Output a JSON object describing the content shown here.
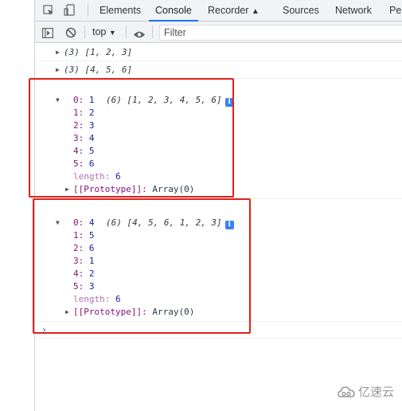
{
  "devtools": {
    "tabs": [
      {
        "label": "Elements",
        "active": false
      },
      {
        "label": "Console",
        "active": true
      },
      {
        "label": "Recorder",
        "active": false
      },
      {
        "label": "Sources",
        "active": false
      },
      {
        "label": "Network",
        "active": false
      },
      {
        "label": "Per",
        "active": false
      }
    ],
    "toolbar": {
      "context": "top",
      "filter_placeholder": "Filter"
    }
  },
  "console": {
    "collapsed": [
      {
        "summary": "(3) [1, 2, 3]"
      },
      {
        "summary": "(3) [4, 5, 6]"
      }
    ],
    "expanded": [
      {
        "summary": "(6) [1, 2, 3, 4, 5, 6]",
        "items": [
          {
            "key": "0:",
            "val": "1"
          },
          {
            "key": "1:",
            "val": "2"
          },
          {
            "key": "2:",
            "val": "3"
          },
          {
            "key": "3:",
            "val": "4"
          },
          {
            "key": "4:",
            "val": "5"
          },
          {
            "key": "5:",
            "val": "6"
          }
        ],
        "length_key": "length:",
        "length_val": "6",
        "proto_key": "[[Prototype]]:",
        "proto_val": "Array(0)"
      },
      {
        "summary": "(6) [4, 5, 6, 1, 2, 3]",
        "items": [
          {
            "key": "0:",
            "val": "4"
          },
          {
            "key": "1:",
            "val": "5"
          },
          {
            "key": "2:",
            "val": "6"
          },
          {
            "key": "3:",
            "val": "1"
          },
          {
            "key": "4:",
            "val": "2"
          },
          {
            "key": "5:",
            "val": "3"
          }
        ],
        "length_key": "length:",
        "length_val": "6",
        "proto_key": "[[Prototype]]:",
        "proto_val": "Array(0)"
      }
    ],
    "prompt": "›",
    "info_badge": "i"
  },
  "watermark": "亿速云",
  "colors": {
    "highlight_box": "#e0201b",
    "active_tab_underline": "#1a73e8"
  }
}
